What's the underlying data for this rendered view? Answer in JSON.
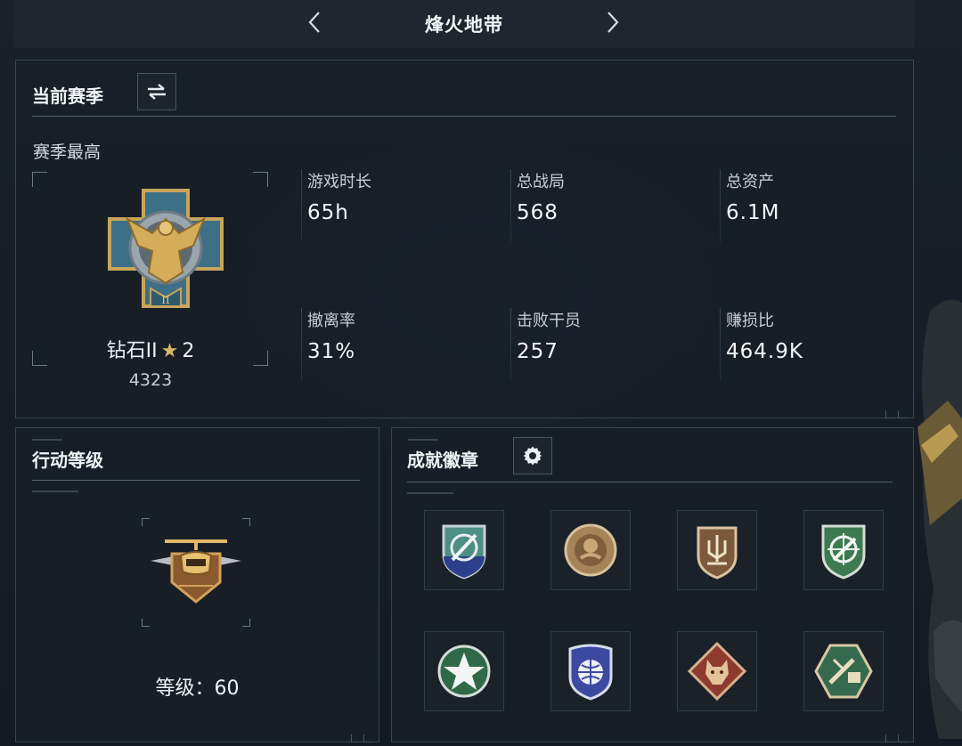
{
  "header": {
    "title": "烽火地带",
    "prev_icon": "chevron-left-icon",
    "next_icon": "chevron-right-icon"
  },
  "season": {
    "title": "当前赛季",
    "switch_icon": "swap-icon",
    "subtitle": "赛季最高",
    "rank": {
      "name": "钻石II",
      "stars": "2",
      "score": "4323",
      "tier_numeral": "II"
    },
    "stats": [
      {
        "label": "游戏时长",
        "value": "65h"
      },
      {
        "label": "总战局",
        "value": "568"
      },
      {
        "label": "总资产",
        "value": "6.1M"
      },
      {
        "label": "撤离率",
        "value": "31%"
      },
      {
        "label": "击败干员",
        "value": "257"
      },
      {
        "label": "赚损比",
        "value": "464.9K"
      }
    ]
  },
  "level": {
    "title": "行动等级",
    "label": "等级：60"
  },
  "badges": {
    "title": "成就徽章",
    "settings_icon": "gear-icon",
    "items": [
      {
        "icon": "blue-shield-rocket-badge-icon"
      },
      {
        "icon": "bronze-circle-emblem-badge-icon"
      },
      {
        "icon": "bronze-shield-trident-badge-icon"
      },
      {
        "icon": "green-shield-crosshair-badge-icon"
      },
      {
        "icon": "green-circle-star-badge-icon"
      },
      {
        "icon": "blue-shield-globe-badge-icon"
      },
      {
        "icon": "red-diamond-wolf-badge-icon"
      },
      {
        "icon": "green-hexagon-tools-badge-icon"
      }
    ]
  }
}
